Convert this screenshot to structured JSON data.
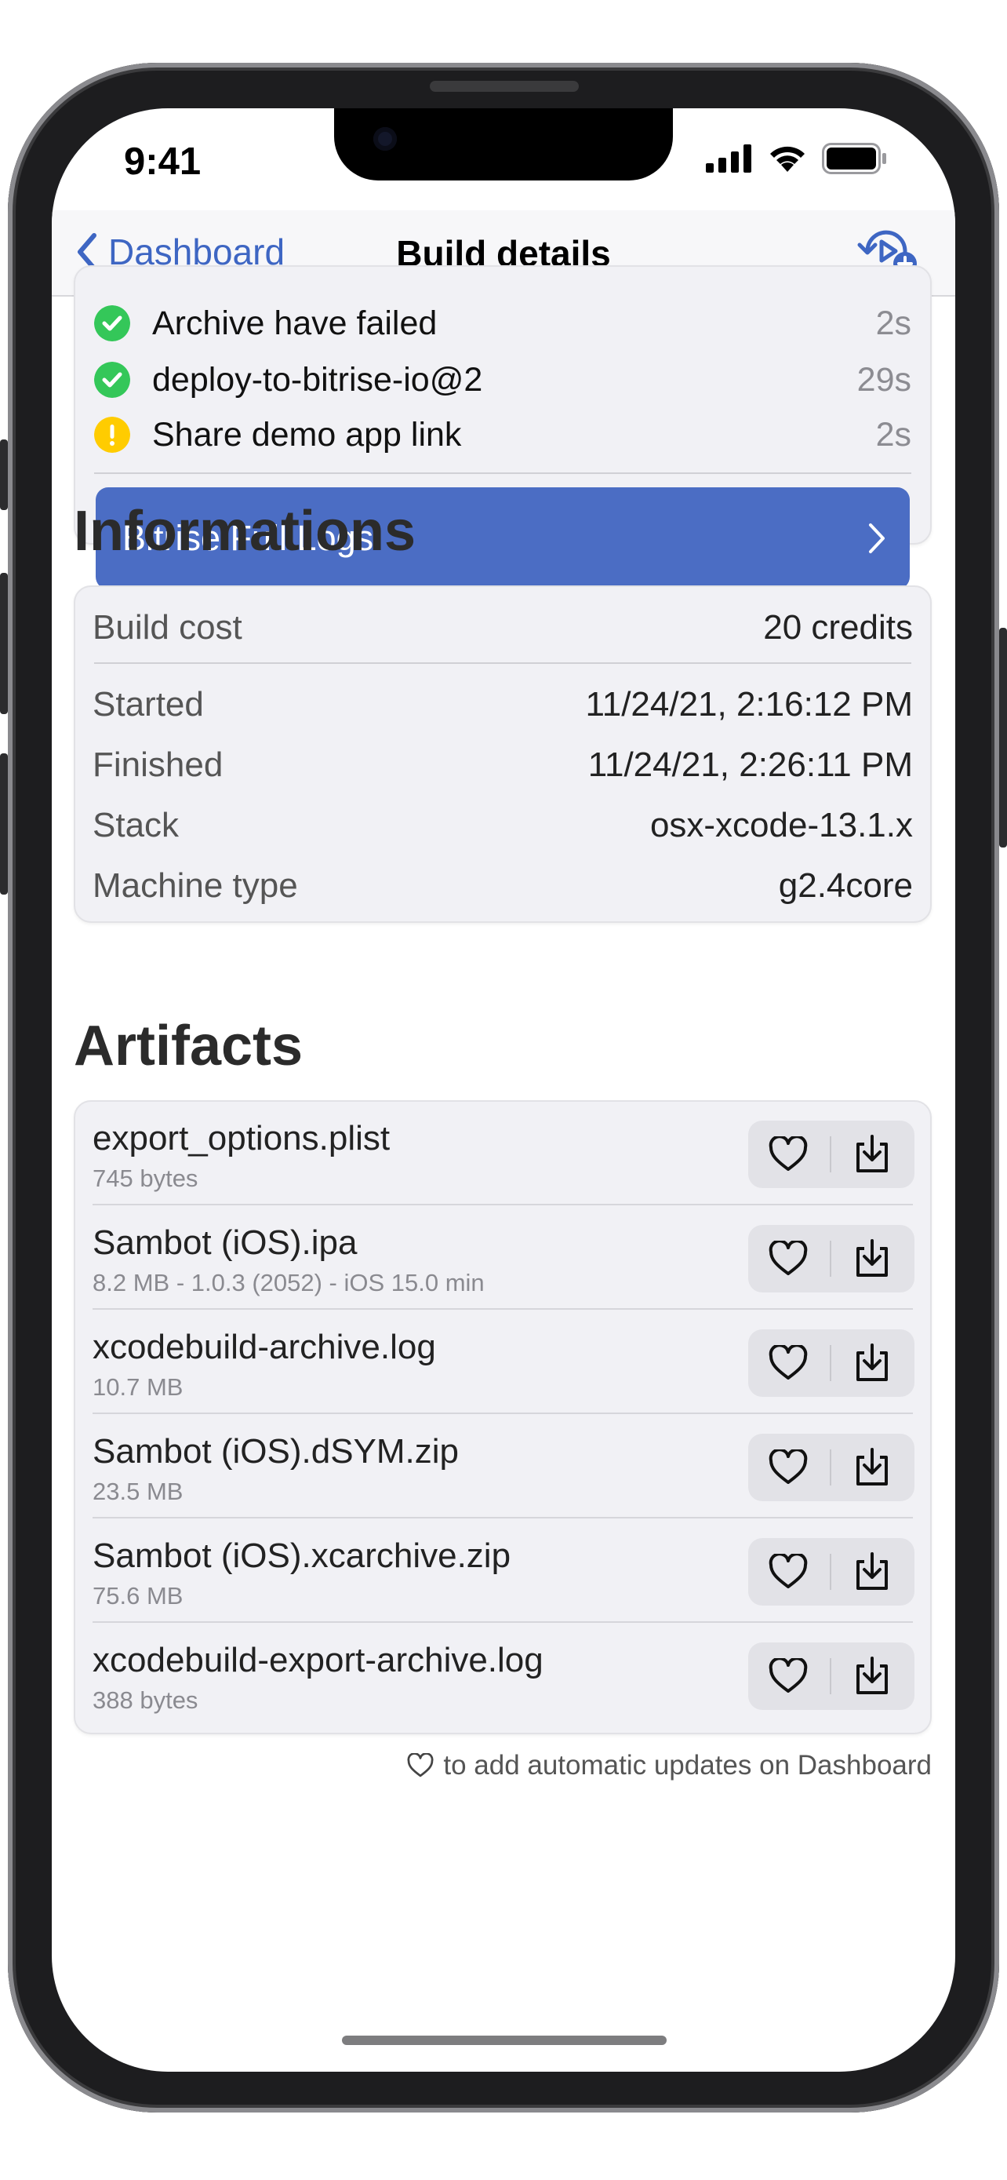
{
  "status_bar": {
    "time": "9:41"
  },
  "nav": {
    "back_label": "Dashboard",
    "title": "Build details"
  },
  "steps": [
    {
      "name": "Archive have failed",
      "duration": "2s",
      "status": "success"
    },
    {
      "name": "deploy-to-bitrise-io@2",
      "duration": "29s",
      "status": "success"
    },
    {
      "name": "Share demo app link",
      "duration": "2s",
      "status": "warning"
    }
  ],
  "logs_button": {
    "label": "Bitrise Full Logs"
  },
  "informations": {
    "title": "Informations",
    "build_cost": {
      "label": "Build cost",
      "value": "20 credits"
    },
    "rows": [
      {
        "label": "Started",
        "value": "11/24/21, 2:16:12 PM"
      },
      {
        "label": "Finished",
        "value": "11/24/21, 2:26:11 PM"
      },
      {
        "label": "Stack",
        "value": "osx-xcode-13.1.x"
      },
      {
        "label": "Machine type",
        "value": "g2.4core"
      }
    ]
  },
  "artifacts": {
    "title": "Artifacts",
    "items": [
      {
        "name": "export_options.plist",
        "meta": "745 bytes"
      },
      {
        "name": "Sambot (iOS).ipa",
        "meta": "8.2 MB - 1.0.3 (2052) - iOS 15.0 min"
      },
      {
        "name": "xcodebuild-archive.log",
        "meta": "10.7 MB"
      },
      {
        "name": "Sambot (iOS).dSYM.zip",
        "meta": "23.5 MB"
      },
      {
        "name": "Sambot (iOS).xcarchive.zip",
        "meta": "75.6 MB"
      },
      {
        "name": "xcodebuild-export-archive.log",
        "meta": "388 bytes"
      }
    ],
    "footnote": "to add automatic updates on Dashboard"
  },
  "colors": {
    "accent": "#3e66c3",
    "button": "#4b6dc4",
    "success": "#34c759",
    "warning": "#ffcc00"
  }
}
